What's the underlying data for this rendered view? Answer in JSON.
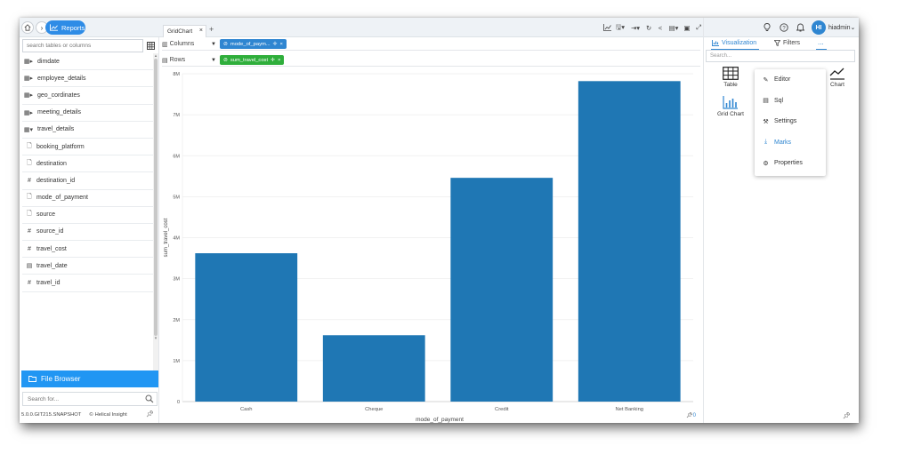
{
  "nav": {
    "reports_label": "Reports"
  },
  "left": {
    "search_placeholder": "search tables or columns",
    "tree": [
      {
        "label": "dimdate",
        "type": "table",
        "expanded": false
      },
      {
        "label": "employee_details",
        "type": "table",
        "expanded": false
      },
      {
        "label": "geo_cordinates",
        "type": "table",
        "expanded": false
      },
      {
        "label": "meeting_details",
        "type": "table",
        "expanded": false
      },
      {
        "label": "travel_details",
        "type": "table",
        "expanded": true
      },
      {
        "label": "booking_platform",
        "type": "text"
      },
      {
        "label": "destination",
        "type": "text"
      },
      {
        "label": "destination_id",
        "type": "number"
      },
      {
        "label": "mode_of_payment",
        "type": "text"
      },
      {
        "label": "source",
        "type": "text"
      },
      {
        "label": "source_id",
        "type": "number"
      },
      {
        "label": "travel_cost",
        "type": "number"
      },
      {
        "label": "travel_date",
        "type": "date"
      },
      {
        "label": "travel_id",
        "type": "number"
      }
    ],
    "file_browser_label": "File Browser",
    "search_for_placeholder": "Search for...",
    "version": "5.0.0.GIT215.SNAPSHOT",
    "brand": "Helical Insight"
  },
  "center": {
    "tab_label": "GridChart",
    "columns_label": "Columns",
    "rows_label": "Rows",
    "columns_pill": "mode_of_paym...",
    "rows_pill": "sum_travel_cost",
    "chart_pin_count": "0"
  },
  "chart_data": {
    "type": "bar",
    "categories": [
      "Cash",
      "Cheque",
      "Credit",
      "Net Banking"
    ],
    "values": [
      3620000,
      1620000,
      5460000,
      7820000
    ],
    "xlabel": "mode_of_payment",
    "ylabel": "sum_travel_cost",
    "ylim": [
      0,
      8000000
    ],
    "yticks": [
      {
        "value": 0,
        "label": "0"
      },
      {
        "value": 1000000,
        "label": "1M"
      },
      {
        "value": 2000000,
        "label": "2M"
      },
      {
        "value": 3000000,
        "label": "3M"
      },
      {
        "value": 4000000,
        "label": "4M"
      },
      {
        "value": 5000000,
        "label": "5M"
      },
      {
        "value": 6000000,
        "label": "6M"
      },
      {
        "value": 7000000,
        "label": "7M"
      },
      {
        "value": 8000000,
        "label": "8M"
      }
    ],
    "bar_color": "#1f77b4",
    "grid": true
  },
  "right": {
    "user_initials": "HI",
    "user_name": "hiadmin",
    "tab_visualization": "Visualization",
    "tab_filters": "Filters",
    "tab_more": "...",
    "search_placeholder": "Search...",
    "viz_items": [
      {
        "label": "Table",
        "icon": "table-icon"
      },
      {
        "label": "Chart",
        "icon": "line-chart-icon"
      },
      {
        "label": "Grid Chart",
        "icon": "bar-chart-icon"
      }
    ],
    "menu": [
      {
        "label": "Editor",
        "icon": "pencil-icon"
      },
      {
        "label": "Sql",
        "icon": "sql-icon"
      },
      {
        "label": "Settings",
        "icon": "wrench-icon"
      },
      {
        "label": "Marks",
        "icon": "marks-icon",
        "active": true
      },
      {
        "label": "Properties",
        "icon": "gear-icon"
      }
    ]
  },
  "colors": {
    "accent": "#2196f3",
    "green_pill": "#2fae3b",
    "blue_pill": "#2f86d1"
  }
}
